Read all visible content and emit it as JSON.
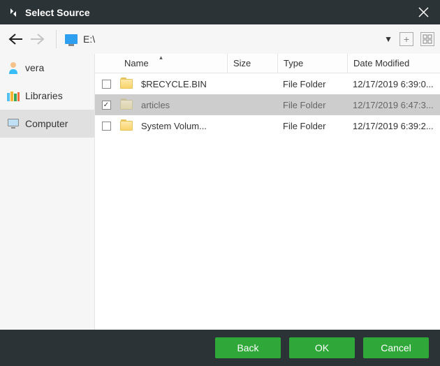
{
  "title": "Select Source",
  "path": "E:\\",
  "sidebar": {
    "items": [
      {
        "label": "vera",
        "icon": "user"
      },
      {
        "label": "Libraries",
        "icon": "library"
      },
      {
        "label": "Computer",
        "icon": "monitor"
      }
    ],
    "active_index": 2
  },
  "columns": {
    "name": "Name",
    "size": "Size",
    "type": "Type",
    "date": "Date Modified"
  },
  "rows": [
    {
      "checked": false,
      "name": "$RECYCLE.BIN",
      "size": "",
      "type": "File Folder",
      "date": "12/17/2019 6:39:0...",
      "selected": false
    },
    {
      "checked": true,
      "name": "articles",
      "size": "",
      "type": "File Folder",
      "date": "12/17/2019 6:47:3...",
      "selected": true
    },
    {
      "checked": false,
      "name": "System Volum...",
      "size": "",
      "type": "File Folder",
      "date": "12/17/2019 6:39:2...",
      "selected": false
    }
  ],
  "buttons": {
    "back": "Back",
    "ok": "OK",
    "cancel": "Cancel"
  }
}
